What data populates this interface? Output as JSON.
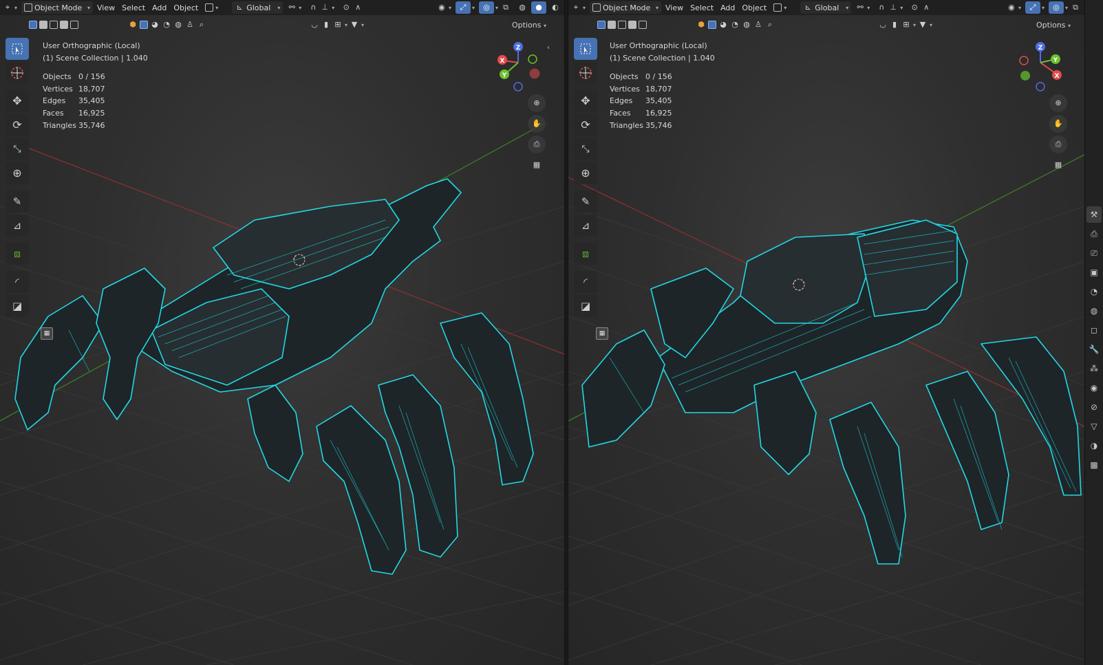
{
  "header": {
    "mode_label": "Object Mode",
    "menus": [
      "View",
      "Select",
      "Add",
      "Object"
    ],
    "orientation_label": "Global",
    "options_label": "Options"
  },
  "viewports": [
    {
      "view_name": "User Orthographic (Local)",
      "collection": "(1) Scene Collection | 1.040",
      "stats": [
        {
          "label": "Objects",
          "value": "0 / 156"
        },
        {
          "label": "Vertices",
          "value": "18,707"
        },
        {
          "label": "Edges",
          "value": "35,405"
        },
        {
          "label": "Faces",
          "value": "16,925"
        },
        {
          "label": "Triangles",
          "value": "35,746"
        }
      ]
    },
    {
      "view_name": "User Orthographic (Local)",
      "collection": "(1) Scene Collection | 1.040",
      "stats": [
        {
          "label": "Objects",
          "value": "0 / 156"
        },
        {
          "label": "Vertices",
          "value": "18,707"
        },
        {
          "label": "Edges",
          "value": "35,405"
        },
        {
          "label": "Faces",
          "value": "16,925"
        },
        {
          "label": "Triangles",
          "value": "35,746"
        }
      ]
    }
  ],
  "gizmo_axes": {
    "x": "X",
    "y": "Y",
    "z": "Z"
  },
  "colors": {
    "wireframe": "#22d8e6",
    "axis_x": "#e24b4b",
    "axis_y": "#6ac22e",
    "axis_z": "#4e6ee4",
    "active_blue": "#4772b3"
  },
  "icons": {
    "toolbar": [
      "select-box-icon",
      "cursor-icon",
      "move-icon",
      "rotate-icon",
      "scale-icon",
      "transform-icon",
      "annotate-icon",
      "measure-icon",
      "add-cube-icon",
      "shear-icon",
      "box-icon"
    ],
    "navigation": [
      "zoom-icon",
      "pan-hand-icon",
      "camera-icon",
      "grid-icon"
    ],
    "properties": [
      "tool-icon",
      "render-icon",
      "output-icon",
      "view-layer-icon",
      "scene-icon",
      "world-icon",
      "object-icon",
      "modifier-icon",
      "particles-icon",
      "physics-icon",
      "constraints-icon",
      "data-icon",
      "material-icon",
      "texture-icon"
    ]
  }
}
